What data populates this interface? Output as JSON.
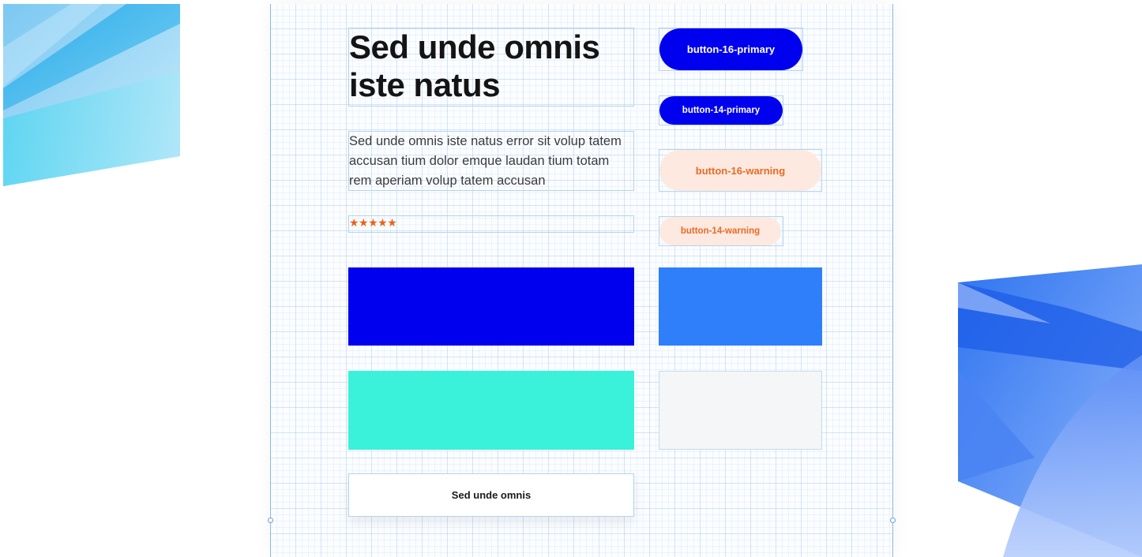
{
  "headline": "Sed unde omnis iste natus",
  "paragraph": "Sed unde omnis iste natus error sit volup tatem accusan tium dolor emque laudan tium totam rem aperiam volup tatem accusan",
  "rating": {
    "stars": "★★★★★",
    "value": 5,
    "max": 5,
    "color": "#e8631a"
  },
  "buttons": {
    "primary_16": "button-16-primary",
    "primary_14": "button-14-primary",
    "warning_16": "button-16-warning",
    "warning_14": "button-14-warning"
  },
  "card_button": "Sed unde omnis",
  "colors": {
    "primary": "#0000ee",
    "primary_light": "#2f7ffb",
    "accent": "#3af1da",
    "neutral": "#f4f6f8",
    "warning_bg": "#fde9e0",
    "warning_text": "#ea6a24"
  }
}
